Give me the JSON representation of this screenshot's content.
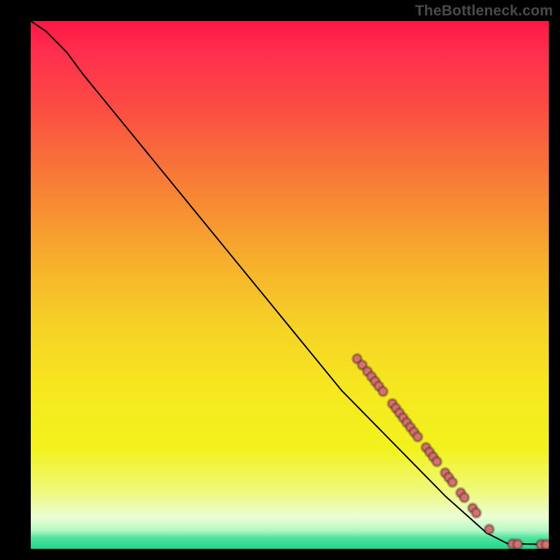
{
  "watermark": "TheBottleneck.com",
  "chart_data": {
    "type": "line",
    "title": "",
    "xlabel": "",
    "ylabel": "",
    "xlim": [
      0,
      100
    ],
    "ylim": [
      0,
      100
    ],
    "grid": false,
    "legend": false,
    "curve": [
      {
        "x": 0,
        "y": 100
      },
      {
        "x": 3,
        "y": 98
      },
      {
        "x": 7,
        "y": 94
      },
      {
        "x": 10,
        "y": 90
      },
      {
        "x": 20,
        "y": 78
      },
      {
        "x": 30,
        "y": 66
      },
      {
        "x": 40,
        "y": 54
      },
      {
        "x": 50,
        "y": 42
      },
      {
        "x": 60,
        "y": 30
      },
      {
        "x": 70,
        "y": 20
      },
      {
        "x": 80,
        "y": 10
      },
      {
        "x": 88,
        "y": 3
      },
      {
        "x": 92,
        "y": 1
      },
      {
        "x": 100,
        "y": 0.8
      }
    ],
    "markers": [
      {
        "x": 63,
        "y": 36
      },
      {
        "x": 64,
        "y": 34.8
      },
      {
        "x": 65,
        "y": 33.6
      },
      {
        "x": 65.8,
        "y": 32.6
      },
      {
        "x": 66.5,
        "y": 31.7
      },
      {
        "x": 67.2,
        "y": 30.8
      },
      {
        "x": 68,
        "y": 29.8
      },
      {
        "x": 69.8,
        "y": 27.5
      },
      {
        "x": 70.5,
        "y": 26.6
      },
      {
        "x": 71.2,
        "y": 25.7
      },
      {
        "x": 71.9,
        "y": 24.8
      },
      {
        "x": 72.6,
        "y": 23.9
      },
      {
        "x": 73.3,
        "y": 23
      },
      {
        "x": 74,
        "y": 22.1
      },
      {
        "x": 74.7,
        "y": 21.2
      },
      {
        "x": 76.3,
        "y": 19.2
      },
      {
        "x": 77,
        "y": 18.3
      },
      {
        "x": 77.7,
        "y": 17.4
      },
      {
        "x": 78.4,
        "y": 16.5
      },
      {
        "x": 80,
        "y": 14.4
      },
      {
        "x": 80.7,
        "y": 13.5
      },
      {
        "x": 81.4,
        "y": 12.6
      },
      {
        "x": 83,
        "y": 10.6
      },
      {
        "x": 83.7,
        "y": 9.7
      },
      {
        "x": 85.3,
        "y": 7.7
      },
      {
        "x": 86,
        "y": 6.8
      },
      {
        "x": 88.5,
        "y": 3.7
      },
      {
        "x": 93,
        "y": 0.9
      },
      {
        "x": 94,
        "y": 0.85
      },
      {
        "x": 98.5,
        "y": 0.8
      },
      {
        "x": 99.5,
        "y": 0.8
      }
    ],
    "marker_radius": 0.85,
    "marker_color": "#d67070",
    "line_color": "#000000"
  }
}
